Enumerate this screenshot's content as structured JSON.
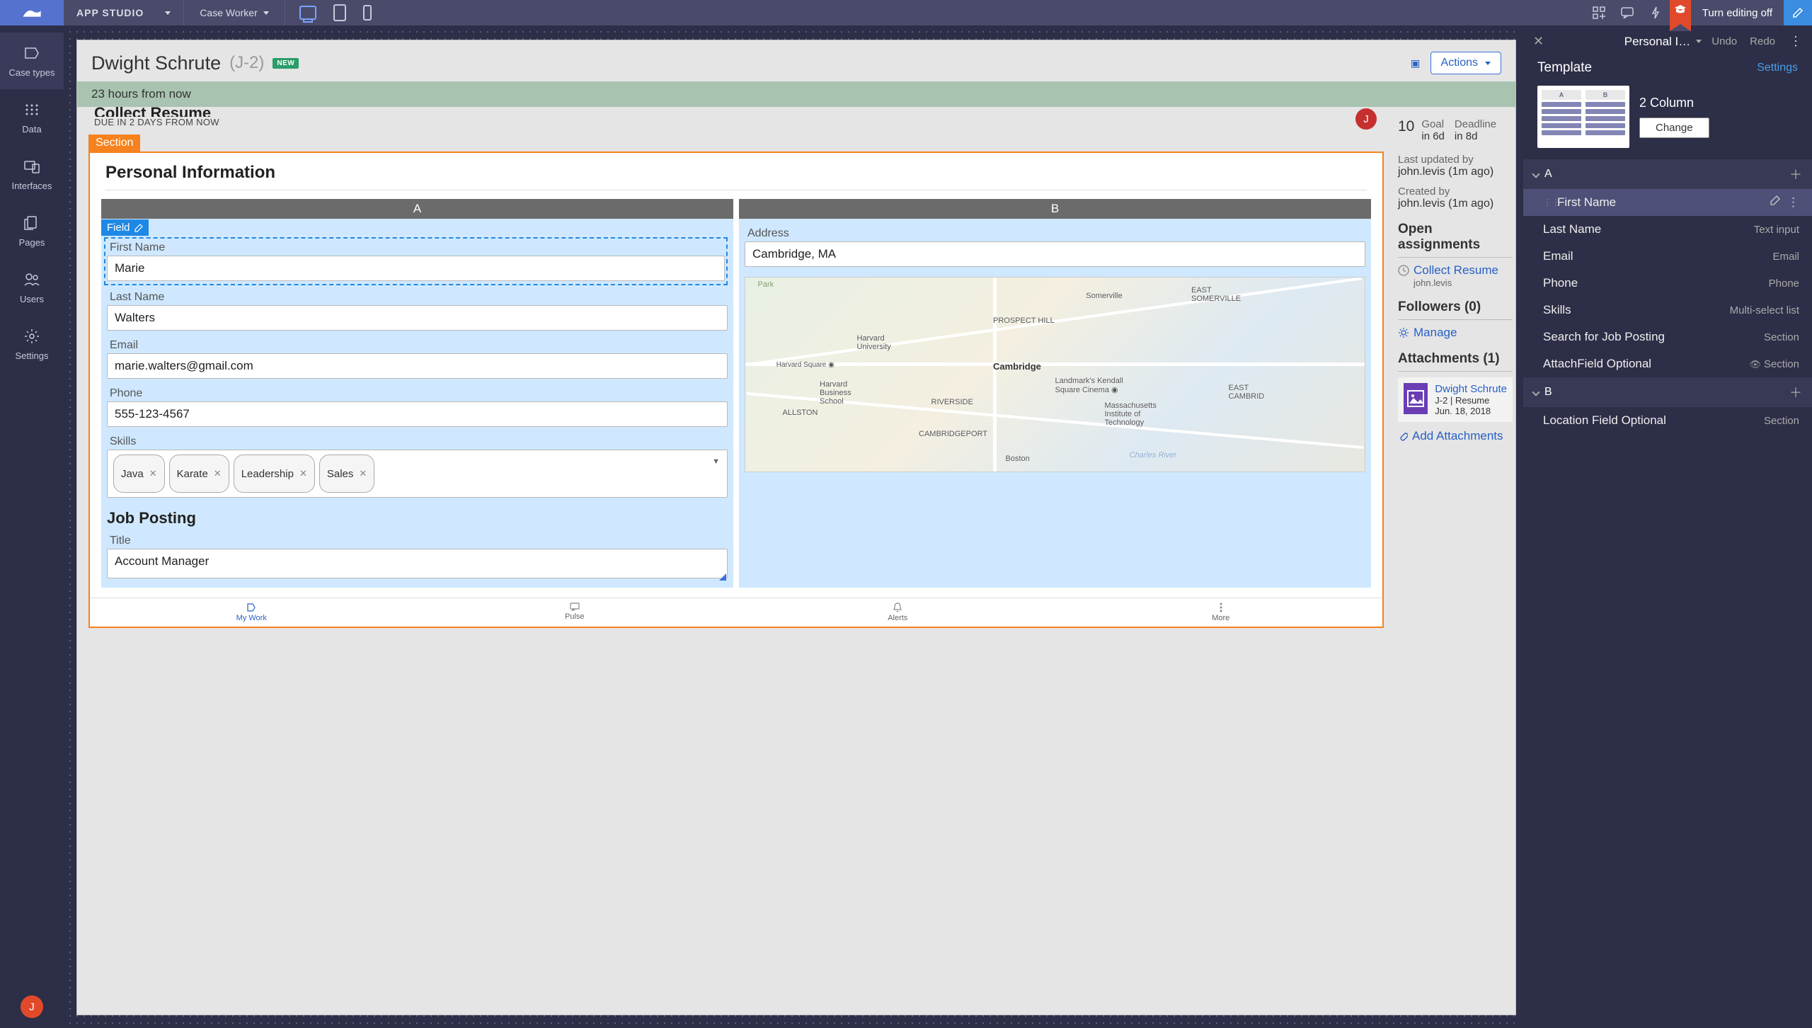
{
  "topbar": {
    "app_title": "APP STUDIO",
    "role": "Case Worker",
    "editing_label": "Turn editing off"
  },
  "leftnav": {
    "items": [
      {
        "label": "Case types"
      },
      {
        "label": "Data"
      },
      {
        "label": "Interfaces"
      },
      {
        "label": "Pages"
      },
      {
        "label": "Users"
      },
      {
        "label": "Settings"
      }
    ],
    "user_initial": "J"
  },
  "case": {
    "name": "Dwight Schrute",
    "id": "(J-2)",
    "badge": "NEW",
    "actions_label": "Actions",
    "deadline_text": "23 hours from now",
    "task": {
      "title": "Collect Resume",
      "due": "DUE IN 2 DAYS FROM NOW",
      "avatar": "J"
    },
    "section_tab": "Section",
    "section_title": "Personal Information",
    "field_tab": "Field",
    "col_a_header": "A",
    "col_b_header": "B",
    "fields": {
      "first_name_label": "First Name",
      "first_name_value": "Marie",
      "last_name_label": "Last Name",
      "last_name_value": "Walters",
      "email_label": "Email",
      "email_value": "marie.walters@gmail.com",
      "phone_label": "Phone",
      "phone_value": "555-123-4567",
      "skills_label": "Skills",
      "skills": [
        "Java",
        "Karate",
        "Leadership",
        "Sales"
      ],
      "address_label": "Address",
      "address_value": "Cambridge, MA",
      "job_heading": "Job Posting",
      "title_label": "Title",
      "title_value": "Account Manager"
    },
    "bottom_tabs": {
      "my_work": "My Work",
      "pulse": "Pulse",
      "alerts": "Alerts",
      "more": "More"
    }
  },
  "caseside": {
    "count": "10",
    "goal_label": "Goal",
    "goal_value": "in 6d",
    "deadline_label": "Deadline",
    "deadline_value": "in 8d",
    "updated_label": "Last updated by",
    "updated_value": "john.levis (1m ago)",
    "created_label": "Created by",
    "created_value": "john.levis (1m ago)",
    "open_heading": "Open assignments",
    "open_link": "Collect Resume",
    "open_sub": "john.levis",
    "followers_heading": "Followers (0)",
    "manage_link": "Manage",
    "attachments_heading": "Attachments (1)",
    "attach_name": "Dwight Schrute",
    "attach_meta": "J-2 | Resume",
    "attach_date": "Jun. 18, 2018",
    "add_attach": "Add Attachments"
  },
  "proppanel": {
    "title": "Personal I…",
    "undo": "Undo",
    "redo": "Redo",
    "template_label": "Template",
    "settings_link": "Settings",
    "layout_name": "2 Column",
    "change_btn": "Change",
    "groups": {
      "a": "A",
      "b": "B"
    },
    "fields_a": [
      {
        "name": "First Name",
        "type": ""
      },
      {
        "name": "Last Name",
        "type": "Text input"
      },
      {
        "name": "Email",
        "type": "Email"
      },
      {
        "name": "Phone",
        "type": "Phone"
      },
      {
        "name": "Skills",
        "type": "Multi-select list"
      },
      {
        "name": "Search for Job Posting",
        "type": "Section"
      },
      {
        "name": "AttachField Optional",
        "type": "Section",
        "eye": true
      }
    ],
    "fields_b": [
      {
        "name": "Location Field Optional",
        "type": "Section"
      }
    ]
  }
}
